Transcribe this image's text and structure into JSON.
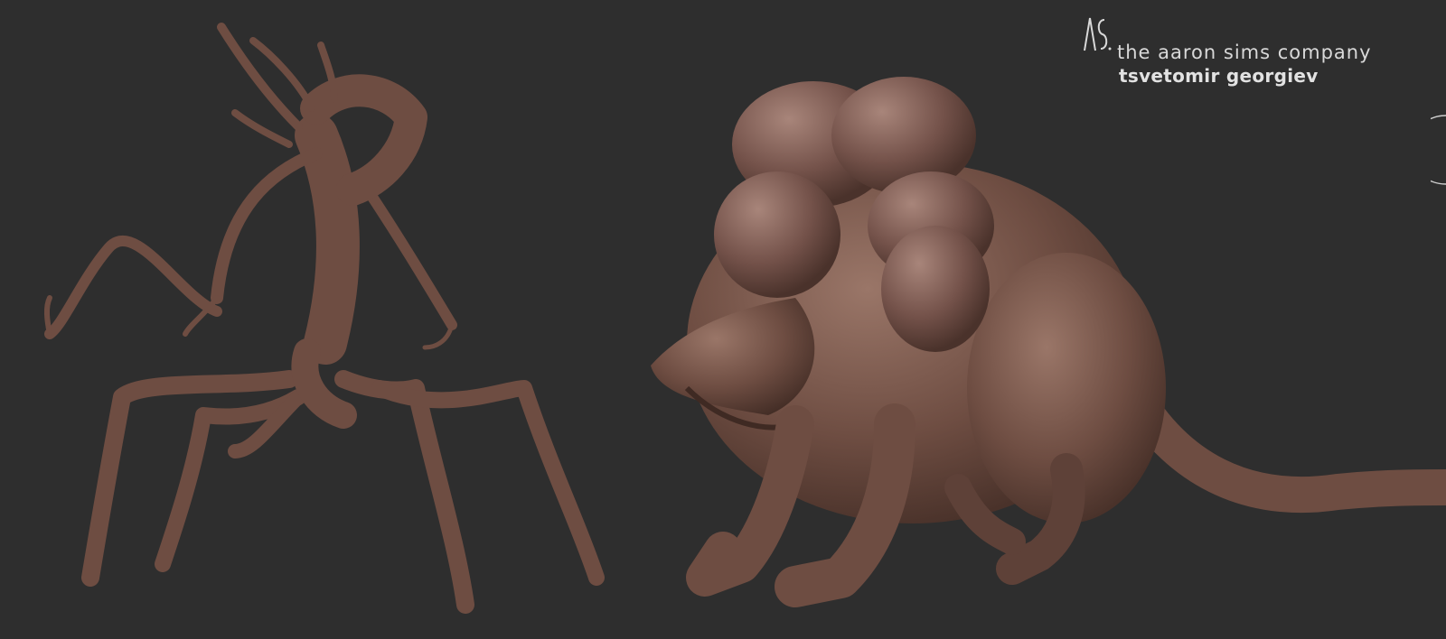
{
  "image": {
    "background_color": "#2e2e2e",
    "clay_color": "#6e4d42",
    "clay_highlight": "#9a7668",
    "clay_shadow": "#3f2a23"
  },
  "watermark": {
    "logo_letters": "AS",
    "company": "the aaron sims company",
    "artist": "tsvetomir georgiev",
    "text_color": "#d9d9d9"
  },
  "subjects": [
    {
      "name": "insectoid-creature-sculpt"
    },
    {
      "name": "bulbous-beast-sculpt"
    }
  ]
}
